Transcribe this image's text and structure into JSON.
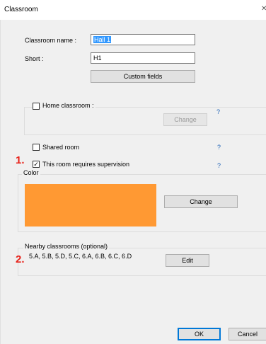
{
  "window": {
    "title": "Classroom"
  },
  "fields": {
    "name_label": "Classroom name :",
    "name_value": "Hall 1",
    "short_label": "Short :",
    "short_value": "H1",
    "custom_fields_label": "Custom fields"
  },
  "home_classroom": {
    "label": "Home classroom :",
    "change_label": "Change",
    "help": "?",
    "checked": false
  },
  "shared_room": {
    "label": "Shared room",
    "help": "?",
    "checked": false
  },
  "supervision": {
    "label": "This room requires supervision",
    "help": "?",
    "checked": true,
    "step": "1."
  },
  "color": {
    "legend": "Color",
    "value": "#ff9933",
    "change_label": "Change"
  },
  "nearby": {
    "legend": "Nearby classrooms (optional)",
    "list": "5.A, 5.B, 5.D, 5.C, 6.A, 6.B, 6.C, 6.D",
    "edit_label": "Edit",
    "step": "2."
  },
  "footer": {
    "ok_label": "OK",
    "cancel_label": "Cancel"
  },
  "icons": {
    "close": "close-icon",
    "checkbox_checked": "checkmark-icon"
  }
}
